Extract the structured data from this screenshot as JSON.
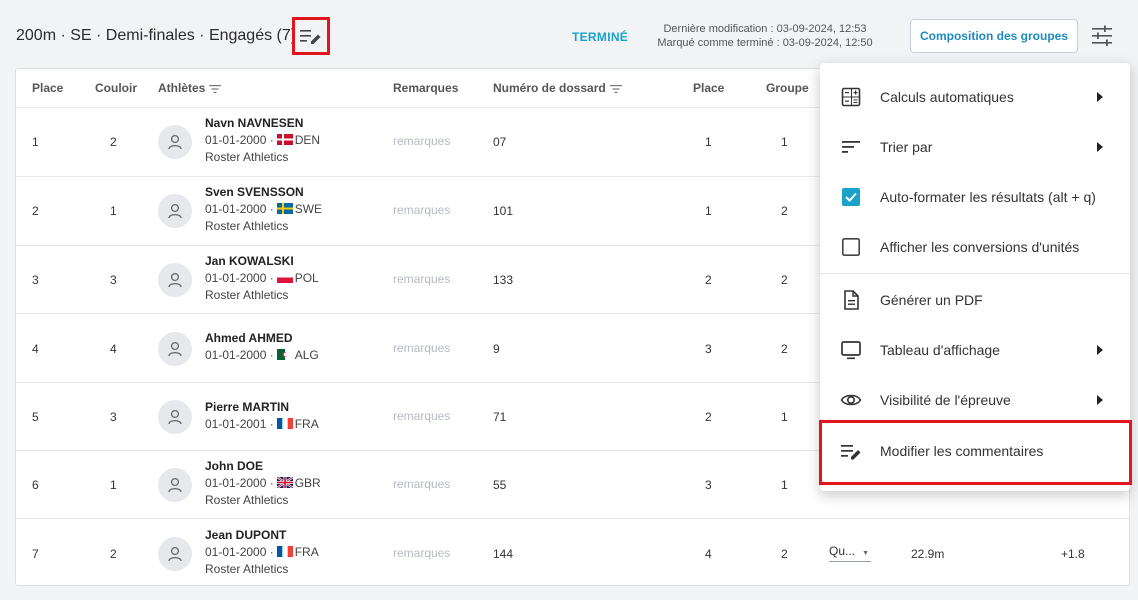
{
  "header": {
    "title": "200m · SE · Demi-finales · Engagés (7)",
    "status": "TERMINÉ",
    "last_modified": "Dernière modification : 03-09-2024, 12:53",
    "marked_done": "Marqué comme terminé : 03-09-2024, 12:50",
    "groups_button": "Composition des groupes"
  },
  "colors": {
    "accent": "#1aa3c9",
    "highlight": "#e0161c",
    "checkbox": "#1aa3c9"
  },
  "table": {
    "columns": [
      "Place",
      "Couloir",
      "Athlètes",
      "Remarques",
      "Numéro de dossard",
      "Place",
      "Groupe"
    ],
    "remarks_placeholder": "remarques",
    "rows": [
      {
        "place": "1",
        "lane": "2",
        "name": "Navn NAVNESEN",
        "dob": "01-01-2000 ·",
        "country": "DEN",
        "flag": "dk-flag",
        "club": "Roster Athletics",
        "bib": "07",
        "place2": "1",
        "group": "1"
      },
      {
        "place": "2",
        "lane": "1",
        "name": "Sven SVENSSON",
        "dob": "01-01-2000 ·",
        "country": "SWE",
        "flag": "se-flag",
        "club": "Roster Athletics",
        "bib": "101",
        "place2": "1",
        "group": "2"
      },
      {
        "place": "3",
        "lane": "3",
        "name": "Jan KOWALSKI",
        "dob": "01-01-2000 ·",
        "country": "POL",
        "flag": "pl-flag",
        "club": "Roster Athletics",
        "bib": "133",
        "place2": "2",
        "group": "2"
      },
      {
        "place": "4",
        "lane": "4",
        "name": "Ahmed AHMED",
        "dob": "01-01-2000 ·",
        "country": "ALG",
        "flag": "dz-flag",
        "club": "",
        "bib": "9",
        "place2": "3",
        "group": "2"
      },
      {
        "place": "5",
        "lane": "3",
        "name": "Pierre MARTIN",
        "dob": "01-01-2001 ·",
        "country": "FRA",
        "flag": "fr-flag",
        "club": "",
        "bib": "71",
        "place2": "2",
        "group": "1"
      },
      {
        "place": "6",
        "lane": "1",
        "name": "John DOE",
        "dob": "01-01-2000 ·",
        "country": "GBR",
        "flag": "gb-flag",
        "club": "Roster Athletics",
        "bib": "55",
        "place2": "3",
        "group": "1"
      },
      {
        "place": "7",
        "lane": "2",
        "name": "Jean DUPONT",
        "dob": "01-01-2000 ·",
        "country": "FRA",
        "flag": "fr-flag",
        "club": "Roster Athletics",
        "bib": "144",
        "place2": "4",
        "group": "2",
        "qualif": "Qu...",
        "result": "22.9m",
        "wind": "+1.8"
      }
    ]
  },
  "menu": {
    "items": [
      {
        "label": "Calculs automatiques",
        "icon": "calculator-icon",
        "submenu": true
      },
      {
        "label": "Trier par",
        "icon": "sort-icon",
        "submenu": true
      },
      {
        "label": "Auto-formater les résultats (alt + q)",
        "icon": "checkbox-checked-icon",
        "checked": true
      },
      {
        "label": "Afficher les conversions d'unités",
        "icon": "checkbox-empty-icon",
        "checked": false
      },
      {
        "label": "Générer un PDF",
        "icon": "pdf-icon"
      },
      {
        "label": "Tableau d'affichage",
        "icon": "monitor-icon",
        "submenu": true
      },
      {
        "label": "Visibilité de l'épreuve",
        "icon": "eye-icon",
        "submenu": true
      },
      {
        "label": "Modifier les commentaires",
        "icon": "edit-notes-icon"
      }
    ]
  }
}
